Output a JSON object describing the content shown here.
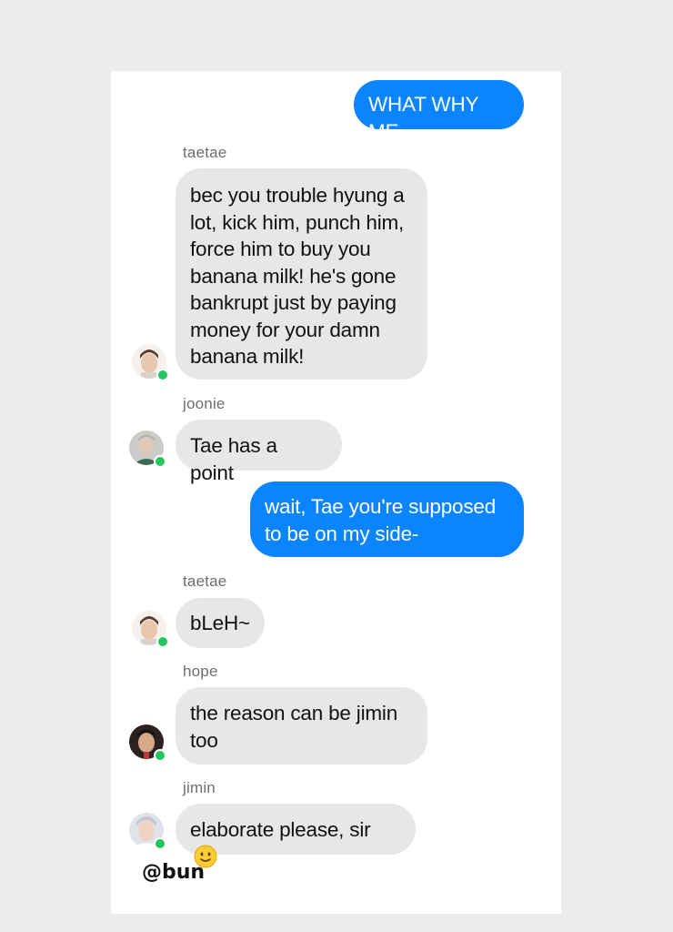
{
  "messages": [
    {
      "id": "m1",
      "direction": "outgoing",
      "text": "WHAT WHY ME"
    },
    {
      "id": "m2",
      "direction": "incoming",
      "sender": "taetae",
      "avatar": "taetae-avatar",
      "text": "bec you trouble hyung a lot, kick him, punch him, force him to buy you banana milk! he's gone bankrupt just by paying money for your damn banana milk!"
    },
    {
      "id": "m3",
      "direction": "incoming",
      "sender": "joonie",
      "avatar": "joonie-avatar",
      "text": "Tae has a point"
    },
    {
      "id": "m4",
      "direction": "outgoing",
      "text": "wait, Tae you're supposed to be on my side-"
    },
    {
      "id": "m5",
      "direction": "incoming",
      "sender": "taetae",
      "avatar": "taetae-avatar",
      "text": "bLeH~"
    },
    {
      "id": "m6",
      "direction": "incoming",
      "sender": "hope",
      "avatar": "hope-avatar",
      "text": "the reason can be jimin too"
    },
    {
      "id": "m7",
      "direction": "incoming",
      "sender": "jimin",
      "avatar": "jimin-avatar",
      "text": "elaborate please, sir",
      "emoji": "slightly-smiling-face-icon"
    }
  ],
  "watermark": "@bun",
  "colors": {
    "outgoing_bubble": "#0a84ff",
    "incoming_bubble": "#e7e7e7",
    "online_dot": "#22c55e",
    "backdrop": "#ececec"
  },
  "icons": {
    "online_status": "online-dot-icon",
    "emoji": "slightly-smiling-face-icon"
  }
}
